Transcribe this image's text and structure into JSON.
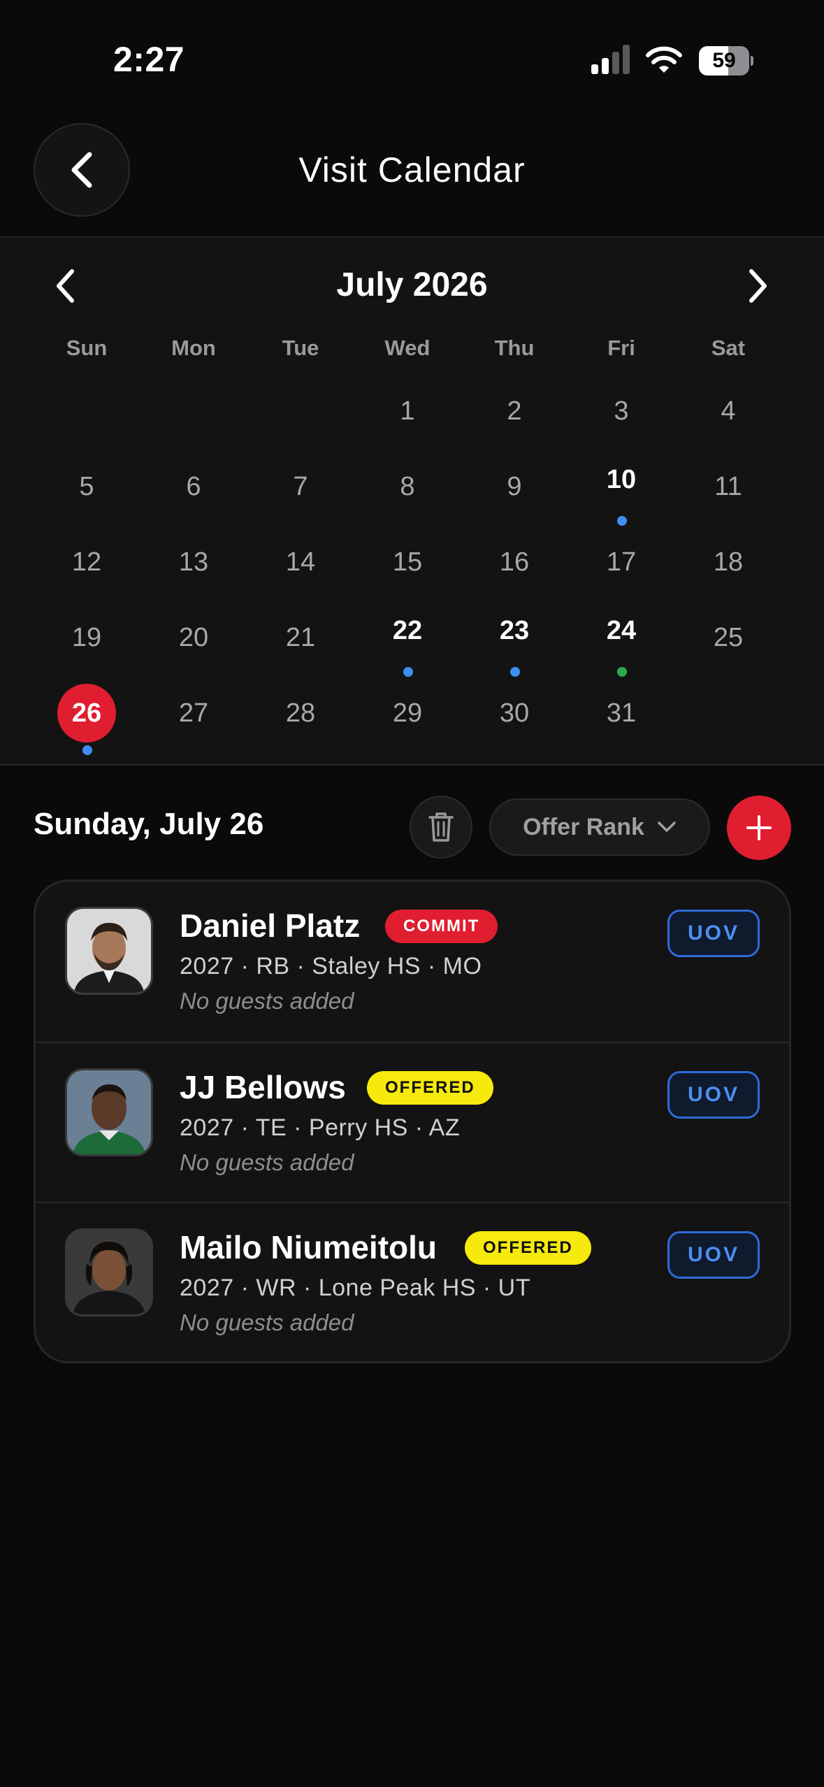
{
  "status_bar": {
    "time": "2:27",
    "battery": "59",
    "battery_level": 0.59
  },
  "header": {
    "title": "Visit Calendar",
    "back_icon": "chevron-left-icon"
  },
  "calendar": {
    "month_label": "July 2026",
    "weekdays": [
      "Sun",
      "Mon",
      "Tue",
      "Wed",
      "Thu",
      "Fri",
      "Sat"
    ],
    "first_weekday_index": 3,
    "days_in_month": 31,
    "selected_day": 26,
    "marked_days": [
      {
        "day": 10,
        "dot_color": "#3d8ff0"
      },
      {
        "day": 22,
        "dot_color": "#3d8ff0"
      },
      {
        "day": 23,
        "dot_color": "#3d8ff0"
      },
      {
        "day": 24,
        "dot_color": "#2ea84f"
      },
      {
        "day": 26,
        "dot_color": "#3d8ff0"
      }
    ]
  },
  "toolbar": {
    "date_heading": "Sunday, July 26",
    "sort_label": "Offer Rank"
  },
  "visits": [
    {
      "name": "Daniel Platz",
      "status": "COMMIT",
      "meta": "2027 · RB · Staley HS · MO",
      "guests": "No guests added",
      "tag": "UOV"
    },
    {
      "name": "JJ Bellows",
      "status": "OFFERED",
      "meta": "2027 · TE · Perry HS · AZ",
      "guests": "No guests added",
      "tag": "UOV"
    },
    {
      "name": "Mailo Niumeitolu",
      "status": "OFFERED",
      "meta": "2027 · WR · Lone Peak HS · UT",
      "guests": "No guests added",
      "tag": "UOV"
    }
  ],
  "colors": {
    "accent_red": "#e01e2f",
    "offered_yellow": "#f5ea0c",
    "uov_blue": "#4c8ff0"
  }
}
